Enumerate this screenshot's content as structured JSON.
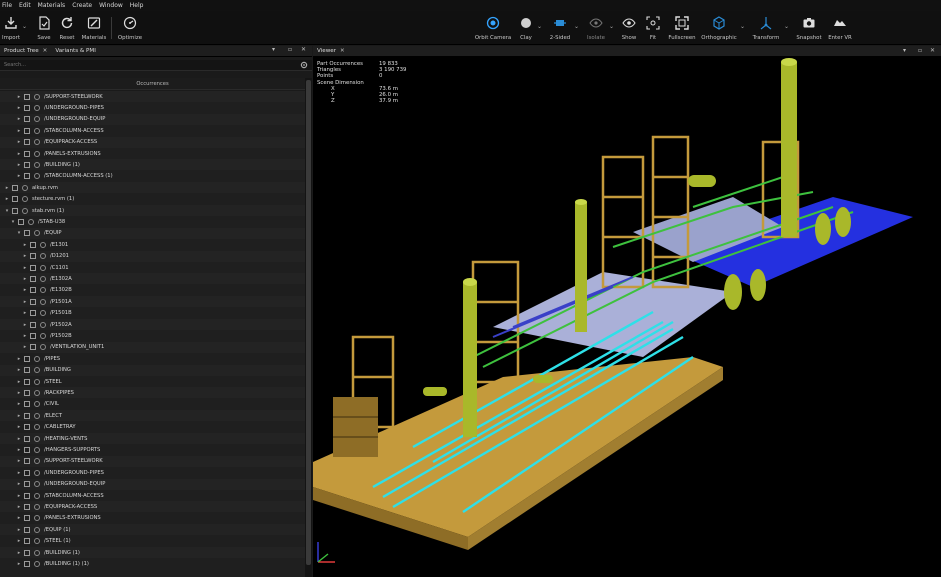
{
  "menu": [
    "File",
    "Edit",
    "Materials",
    "Create",
    "Window",
    "Help"
  ],
  "toolbar_left": [
    {
      "label": "Import",
      "icon": "import-icon"
    },
    {
      "label": "Save",
      "icon": "save-icon"
    },
    {
      "label": "Reset",
      "icon": "reset-icon"
    },
    {
      "label": "Materials",
      "icon": "materials-icon"
    },
    {
      "label": "Optimize",
      "icon": "optimize-icon"
    }
  ],
  "toolbar_right": [
    {
      "label": "Orbit Camera",
      "icon": "orbit-camera-icon"
    },
    {
      "label": "Clay",
      "icon": "clay-icon"
    },
    {
      "label": "2-Sided",
      "icon": "two-sided-icon"
    },
    {
      "label": "Isolate",
      "icon": "isolate-icon"
    },
    {
      "label": "Show",
      "icon": "show-icon"
    },
    {
      "label": "Fit",
      "icon": "fit-icon"
    },
    {
      "label": "Fullscreen",
      "icon": "fullscreen-icon"
    },
    {
      "label": "Orthographic",
      "icon": "orthographic-icon"
    },
    {
      "label": "Transform",
      "icon": "transform-icon"
    },
    {
      "label": "Snapshot",
      "icon": "snapshot-icon"
    },
    {
      "label": "Enter VR",
      "icon": "vr-icon"
    }
  ],
  "left_panel": {
    "tabs": [
      {
        "label": "Product Tree"
      },
      {
        "label": "Variants & PMI"
      }
    ],
    "search_placeholder": "Search...",
    "column_header": "Occurrences"
  },
  "tree_rows": [
    {
      "label": "/SUPPORT-STEELWORK"
    },
    {
      "label": "/UNDERGROUND-PIPES"
    },
    {
      "label": "/UNDERGROUND-EQUIP"
    },
    {
      "label": "/STABCOLUMN-ACCESS"
    },
    {
      "label": "/EQUIPRACK-ACCESS"
    },
    {
      "label": "/PANELS-EXTRUSIONS"
    },
    {
      "label": "/BUILDING (1)"
    },
    {
      "label": "/STABCOLUMN-ACCESS (1)"
    },
    {
      "label": "alkup.rvm"
    },
    {
      "label": "stecture.rvm (1)"
    },
    {
      "label": "stab.rvm (1)"
    },
    {
      "label": "/STAB-U38"
    },
    {
      "label": "/EQUIP"
    },
    {
      "label": "/E1301"
    },
    {
      "label": "/D1201"
    },
    {
      "label": "/C1101"
    },
    {
      "label": "/E1302A"
    },
    {
      "label": "/E1302B"
    },
    {
      "label": "/P1501A"
    },
    {
      "label": "/P1501B"
    },
    {
      "label": "/P1502A"
    },
    {
      "label": "/P1502B"
    },
    {
      "label": "/VENTILATION_UNIT1"
    },
    {
      "label": "/PIPES"
    },
    {
      "label": "/BUILDING"
    },
    {
      "label": "/STEEL"
    },
    {
      "label": "/RACKPIPES"
    },
    {
      "label": "/CIVIL"
    },
    {
      "label": "/ELECT"
    },
    {
      "label": "/CABLETRAY"
    },
    {
      "label": "/HEATING-VENTS"
    },
    {
      "label": "/HANGERS-SUPPORTS"
    },
    {
      "label": "/SUPPORT-STEELWORK"
    },
    {
      "label": "/UNDERGROUND-PIPES"
    },
    {
      "label": "/UNDERGROUND-EQUIP"
    },
    {
      "label": "/STABCOLUMN-ACCESS"
    },
    {
      "label": "/EQUIPRACK-ACCESS"
    },
    {
      "label": "/PANELS-EXTRUSIONS"
    },
    {
      "label": "/EQUIP (1)"
    },
    {
      "label": "/STEEL (1)"
    },
    {
      "label": "/BUILDING (1)"
    },
    {
      "label": "/BUILDING (1) (1)"
    }
  ],
  "viewer": {
    "tab_label": "Viewer",
    "stats": {
      "part_occurrences_label": "Part Occurrences",
      "part_occurrences": "19 833",
      "triangles_label": "Triangles",
      "triangles": "3 190 739",
      "points_label": "Points",
      "points": "0",
      "scene_dimension_label": "Scene Dimension",
      "x_label": "X",
      "x": "73.6 m",
      "y_label": "Y",
      "y": "26.0 m",
      "z_label": "Z",
      "z": "37.9 m"
    }
  },
  "colors": {
    "structure": "#c49a3c",
    "columns": "#a9b82a",
    "piping_cyan": "#2ee0e8",
    "piping_green": "#3ec13e",
    "pad_blue": "#2430e0",
    "slab": "#aab0d8"
  }
}
